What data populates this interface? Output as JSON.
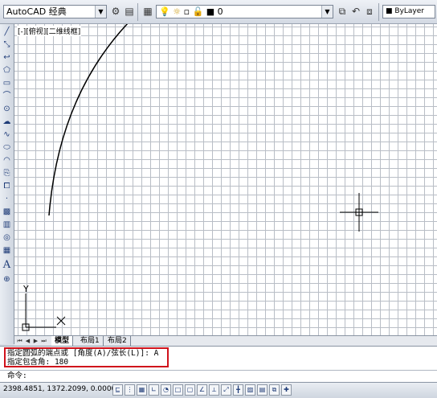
{
  "toolbar": {
    "workspace": "AutoCAD 经典",
    "layer": "0",
    "color": "ByLayer"
  },
  "viewport": {
    "label": "[-][俯视][二维线框]"
  },
  "ucs": {
    "x_label": "X",
    "y_label": "Y"
  },
  "layout_tabs": [
    "模型",
    "布局1",
    "布局2"
  ],
  "command": {
    "history": [
      "指定圆弧的端点或 [角度(A)/弦长(L)]: A",
      "指定包含角: 180"
    ],
    "prompt": "命令:"
  },
  "status": {
    "coordinates": "2398.4851, 1372.2099, 0.0000"
  },
  "colors": {
    "highlight_box": "#d0121b",
    "canvas_background": "#ffffff",
    "grid": "#b9bec6"
  }
}
